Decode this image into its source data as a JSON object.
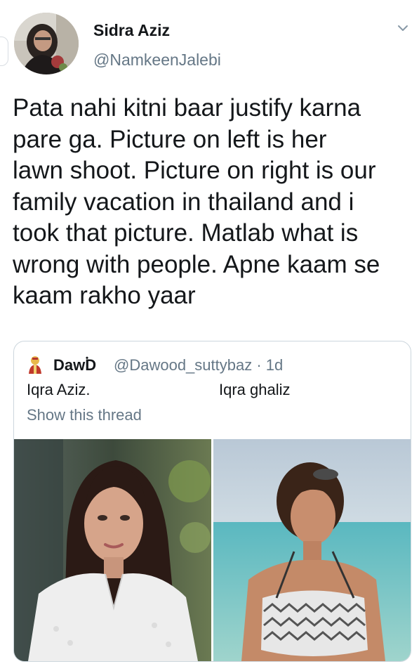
{
  "tweet": {
    "display_name": "Sidra Aziz",
    "handle": "@NamkeenJalebi",
    "text": "Pata nahi kitni baar justify karna\npare ga. Picture on left is her\nlawn shoot. Picture on right is our\nfamily vacation in thailand and i\ntook that picture. Matlab what is\nwrong with people. Apne kaam se\nkaam rakho yaar",
    "menu_icon": "chevron-down-icon",
    "avatar_icon": "avatar"
  },
  "quoted_tweet": {
    "display_name": "Daw۬D",
    "handle_and_time": "@Dawood_suttybaz · 1d",
    "label_left": "Iqra Aziz.",
    "label_right": "Iqra ghaliz",
    "show_thread": "Show this thread",
    "avatar_icon": "emoji-avatar",
    "photos": [
      "woman-in-white-dress-photo",
      "woman-at-beach-photo"
    ]
  },
  "colors": {
    "text_primary": "#14171a",
    "text_secondary": "#657786",
    "border": "#ccd6dd"
  }
}
